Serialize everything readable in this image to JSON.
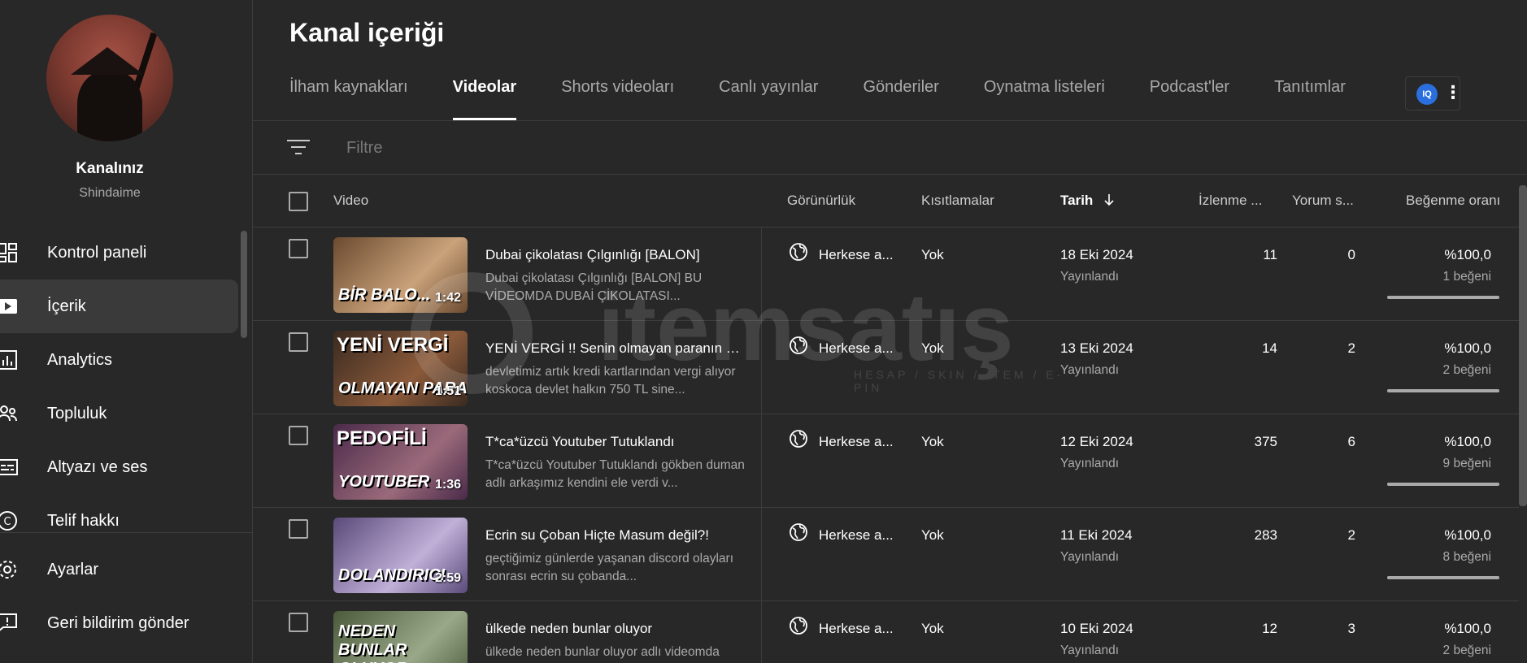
{
  "sidebar": {
    "channel_label": "Kanalınız",
    "channel_handle": "Shindaime",
    "items": [
      {
        "label": "Kontrol paneli",
        "icon": "dashboard-icon"
      },
      {
        "label": "İçerik",
        "icon": "content-icon",
        "active": true
      },
      {
        "label": "Analytics",
        "icon": "analytics-icon"
      },
      {
        "label": "Topluluk",
        "icon": "community-icon"
      },
      {
        "label": "Altyazı ve ses",
        "icon": "subtitles-icon"
      },
      {
        "label": "Telif hakkı",
        "icon": "copyright-icon"
      }
    ],
    "bottom_items": [
      {
        "label": "Ayarlar",
        "icon": "gear-icon"
      },
      {
        "label": "Geri bildirim gönder",
        "icon": "feedback-icon"
      }
    ]
  },
  "main": {
    "title": "Kanal içeriği",
    "tabs": [
      {
        "label": "İlham kaynakları"
      },
      {
        "label": "Videolar",
        "active": true
      },
      {
        "label": "Shorts videoları"
      },
      {
        "label": "Canlı yayınlar"
      },
      {
        "label": "Gönderiler"
      },
      {
        "label": "Oynatma listeleri"
      },
      {
        "label": "Podcast'ler"
      },
      {
        "label": "Tanıtımlar"
      }
    ],
    "extension_label": "IQ",
    "filter_placeholder": "Filtre",
    "columns": {
      "video": "Video",
      "visibility": "Görünürlük",
      "restrictions": "Kısıtlamalar",
      "date": "Tarih",
      "views": "İzlenme ...",
      "comments": "Yorum s...",
      "likes": "Beğenme oranı"
    },
    "rows": [
      {
        "title": "Dubai çikolatası Çılgınlığı [BALON]",
        "description": "Dubai çikolatası Çılgınlığı [BALON] BU VİDEOMDA DUBAİ ÇİKOLATASI...",
        "thumb_top": "",
        "thumb_text": "BİR BALO...",
        "thumb_colors": [
          "#6b4a2f",
          "#c9a27a"
        ],
        "duration": "1:42",
        "visibility": "Herkese a...",
        "restriction": "Yok",
        "date": "18 Eki 2024",
        "status": "Yayınlandı",
        "views": "11",
        "comments": "0",
        "like_pct": "%100,0",
        "like_count": "1 beğeni",
        "like_ratio": 1.0
      },
      {
        "title": "YENİ VERGİ !! Senin olmayan paranın vergisi",
        "description": "devletimiz artık kredi kartlarından vergi alıyor koskoca devlet halkın 750 TL sine...",
        "thumb_top": "YENİ VERGİ",
        "thumb_text": "OLMAYAN PARA",
        "thumb_colors": [
          "#3a2a20",
          "#8a5a3a"
        ],
        "duration": "1:51",
        "visibility": "Herkese a...",
        "restriction": "Yok",
        "date": "13 Eki 2024",
        "status": "Yayınlandı",
        "views": "14",
        "comments": "2",
        "like_pct": "%100,0",
        "like_count": "2 beğeni",
        "like_ratio": 1.0
      },
      {
        "title": "T*ca*üzcü Youtuber Tutuklandı",
        "description": "T*ca*üzcü Youtuber Tutuklandı gökben duman adlı arkaşımız kendini ele verdi v...",
        "thumb_top": "PEDOFİLİ",
        "thumb_text": "YOUTUBER",
        "thumb_colors": [
          "#4a2a4a",
          "#9a6a7a"
        ],
        "duration": "1:36",
        "visibility": "Herkese a...",
        "restriction": "Yok",
        "date": "12 Eki 2024",
        "status": "Yayınlandı",
        "views": "375",
        "comments": "6",
        "like_pct": "%100,0",
        "like_count": "9 beğeni",
        "like_ratio": 1.0
      },
      {
        "title": "Ecrin su Çoban Hiçte Masum değil?!",
        "description": "geçtiğimiz günlerde yaşanan discord olayları sonrası ecrin su çobanda...",
        "thumb_top": "",
        "thumb_text": "DOLANDIRICI",
        "thumb_colors": [
          "#5a4a7a",
          "#c0b0d8"
        ],
        "duration": "2:59",
        "visibility": "Herkese a...",
        "restriction": "Yok",
        "date": "11 Eki 2024",
        "status": "Yayınlandı",
        "views": "283",
        "comments": "2",
        "like_pct": "%100,0",
        "like_count": "8 beğeni",
        "like_ratio": 1.0
      },
      {
        "title": "ülkede neden bunlar oluyor",
        "description": "ülkede neden bunlar oluyor adlı videomda",
        "thumb_top": "",
        "thumb_text": "NEDEN BUNLAR OLUYOR",
        "thumb_colors": [
          "#4a5a3a",
          "#9aa88a"
        ],
        "duration": "",
        "visibility": "Herkese a...",
        "restriction": "Yok",
        "date": "10 Eki 2024",
        "status": "Yayınlandı",
        "views": "12",
        "comments": "3",
        "like_pct": "%100,0",
        "like_count": "2 beğeni",
        "like_ratio": 1.0
      }
    ]
  },
  "watermark": {
    "word": "itemsatış",
    "tagline": "HESAP / SKIN / ITEM / E-PIN"
  }
}
